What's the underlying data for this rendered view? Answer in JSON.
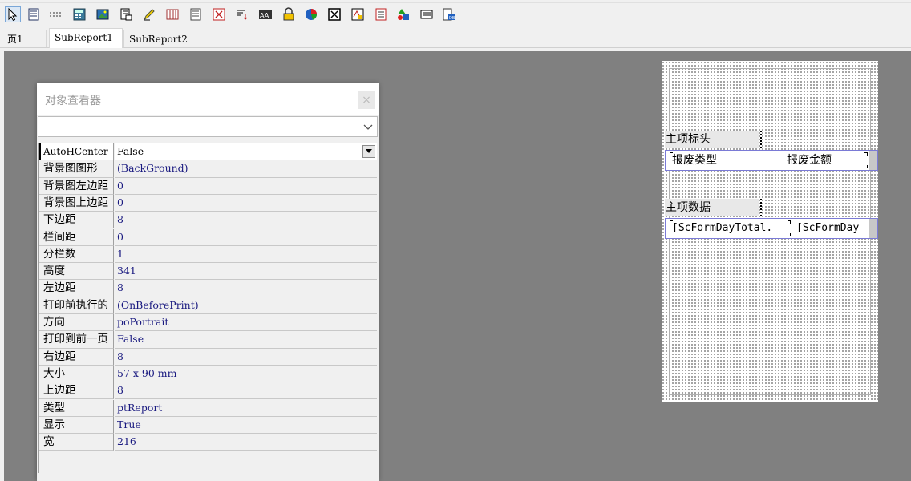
{
  "toolbar": {
    "icons": [
      "select-arrow-icon",
      "band-icon",
      "dotted-line-icon",
      "calculator-icon",
      "image-icon",
      "memo-icon",
      "pen-icon",
      "columns-icon",
      "list-icon",
      "crosstab-icon",
      "sort-icon",
      "ocr-icon",
      "lock-icon",
      "pie-chart-icon",
      "check-box-icon",
      "rich-text-icon",
      "table-icon",
      "shapes-icon",
      "barcode-label-icon",
      "lookup-icon"
    ]
  },
  "tabs": [
    {
      "label": "页1"
    },
    {
      "label": "SubReport1"
    },
    {
      "label": "SubReport2"
    }
  ],
  "inspector": {
    "title": "对象查看器",
    "close_label": "×",
    "combo_value": "",
    "properties": [
      {
        "name": "AutoHCenter",
        "value": "False"
      },
      {
        "name": "背景图图形",
        "value": "(BackGround)"
      },
      {
        "name": "背景图左边距",
        "value": "0"
      },
      {
        "name": "背景图上边距",
        "value": "0"
      },
      {
        "name": "下边距",
        "value": "8"
      },
      {
        "name": "栏间距",
        "value": "0"
      },
      {
        "name": "分栏数",
        "value": "1"
      },
      {
        "name": "高度",
        "value": "341"
      },
      {
        "name": "左边距",
        "value": "8"
      },
      {
        "name": "打印前执行的",
        "value": "(OnBeforePrint)"
      },
      {
        "name": "方向",
        "value": "poPortrait"
      },
      {
        "name": "打印到前一页",
        "value": "False"
      },
      {
        "name": "右边距",
        "value": "8"
      },
      {
        "name": "大小",
        "value": "57 x 90 mm"
      },
      {
        "name": "上边距",
        "value": "8"
      },
      {
        "name": "类型",
        "value": "ptReport"
      },
      {
        "name": "显示",
        "value": "True"
      },
      {
        "name": "宽",
        "value": "216"
      }
    ]
  },
  "report": {
    "header_band": {
      "label": "主项标头",
      "fields": [
        "报废类型",
        "报废金额"
      ]
    },
    "data_band": {
      "label": "主项数据",
      "fields": [
        "[ScFormDayTotal.",
        "[ScFormDay"
      ]
    }
  },
  "colors": {
    "canvas": "#808080",
    "band_border": "#7a7ad6",
    "value_text": "#1a1a80"
  }
}
